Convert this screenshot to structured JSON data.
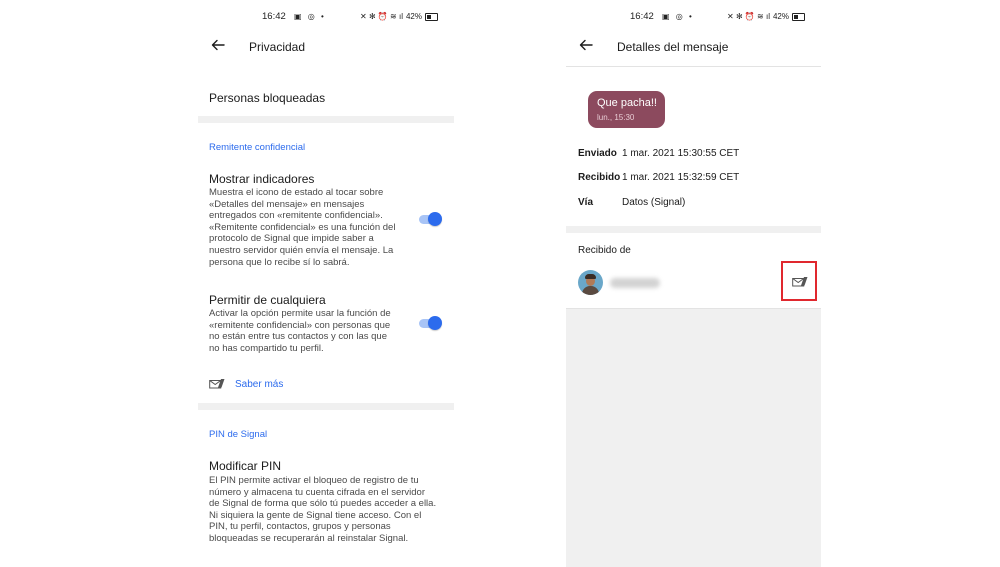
{
  "status_bar": {
    "time": "16:42",
    "left_icons": "▣ ◎ •",
    "right_icons": "✕ ✻ ⏰ ≋ ıl",
    "battery_percent": "42%"
  },
  "left_screen": {
    "title": "Privacidad",
    "blocked_contacts": "Personas bloqueadas",
    "sealed_sender_header": "Remitente confidencial",
    "show_indicators": {
      "title": "Mostrar indicadores",
      "desc": "Muestra el icono de estado al tocar sobre «Detalles del mensaje» en mensajes entregados con «remitente confidencial». «Remitente confidencial» es una función del protocolo de Signal que impide saber a nuestro servidor quién envía el mensaje. La persona que lo recibe sí lo sabrá.",
      "enabled": true
    },
    "allow_anyone": {
      "title": "Permitir de cualquiera",
      "desc": "Activar la opción permite usar la función de «remitente confidencial» con personas que no están entre tus contactos y con las que no has compartido tu perfil.",
      "enabled": true
    },
    "learn_more": "Saber más",
    "pin_header": "PIN de Signal",
    "change_pin": {
      "title": "Modificar PIN",
      "desc": "El PIN permite activar el bloqueo de registro de tu número y almacena tu cuenta cifrada en el servidor de Signal de forma que sólo tú puedes acceder a ella. Ni siquiera la gente de Signal tiene acceso. Con el PIN, tu perfil, contactos, grupos y personas bloqueadas se recuperarán al reinstalar Signal."
    }
  },
  "right_screen": {
    "title": "Detalles del mensaje",
    "message": {
      "text": "Que pacha!!",
      "time": "lun., 15:30"
    },
    "details": [
      {
        "label": "Enviado",
        "value": "1 mar. 2021 15:30:55 CET"
      },
      {
        "label": "Recibido",
        "value": "1 mar. 2021 15:32:59 CET"
      },
      {
        "label": "Vía",
        "value": "Datos (Signal)"
      }
    ],
    "received_from_header": "Recibido de"
  },
  "colors": {
    "accent": "#2c6bed",
    "bubble": "#8c4a5e",
    "highlight": "#e0282e",
    "divider": "#f0f0f0"
  },
  "icons": [
    "back-arrow-icon",
    "sealed-sender-icon",
    "toggle-switch"
  ]
}
